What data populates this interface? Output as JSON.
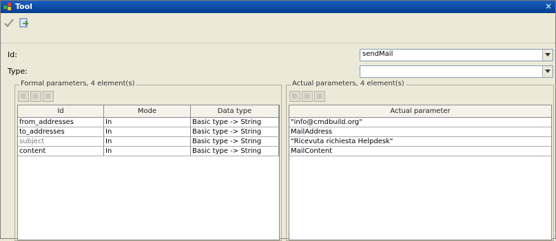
{
  "window": {
    "title": "Tool",
    "close_glyph": "×"
  },
  "toolbar": {
    "icons": [
      "check-icon",
      "export-icon"
    ]
  },
  "form": {
    "id_label": "Id:",
    "id_value": "sendMail",
    "type_label": "Type:",
    "type_value": ""
  },
  "formal": {
    "legend": "Formal parameters, 4 element(s)",
    "columns": [
      "Id",
      "Mode",
      "Data type"
    ],
    "rows": [
      [
        "from_addresses",
        "In",
        "Basic type -> String"
      ],
      [
        "to_addresses",
        "In",
        "Basic type -> String"
      ],
      [
        "subject",
        "In",
        "Basic type -> String"
      ],
      [
        "content",
        "In",
        "Basic type -> String"
      ]
    ]
  },
  "actual": {
    "legend": "Actual parameters, 4 element(s)",
    "columns": [
      "Actual parameter"
    ],
    "rows": [
      [
        "\"info@cmdbuild.org\""
      ],
      [
        "MailAddress"
      ],
      [
        "\"Ricevuta richiesta Helpdesk\""
      ],
      [
        "MailContent"
      ]
    ]
  },
  "colors": {
    "title_bar": "#0b4aa6",
    "window_bg": "#ece9d8"
  }
}
